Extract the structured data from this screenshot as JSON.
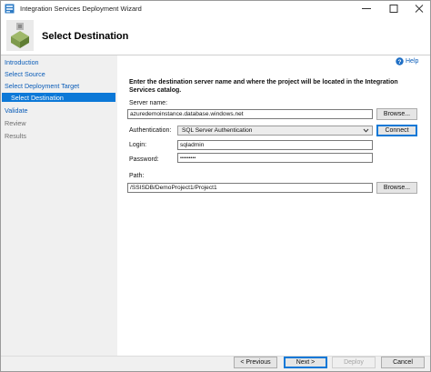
{
  "window": {
    "title": "Integration Services Deployment Wizard"
  },
  "header": {
    "title": "Select Destination"
  },
  "nav": {
    "items": [
      {
        "label": "Introduction"
      },
      {
        "label": "Select Source"
      },
      {
        "label": "Select Deployment Target"
      },
      {
        "label": "Select Destination"
      },
      {
        "label": "Validate"
      },
      {
        "label": "Review"
      },
      {
        "label": "Results"
      }
    ]
  },
  "main": {
    "help_label": "Help",
    "instruction": "Enter the destination server name and where the project will be located in the Integration Services catalog.",
    "server_name_label": "Server name:",
    "server_name_value": "azuredemoinstance.database.windows.net",
    "browse_label": "Browse...",
    "authentication_label": "Authentication:",
    "authentication_value": "SQL Server Authentication",
    "connect_label": "Connect",
    "login_label": "Login:",
    "login_value": "sqladmin",
    "password_label": "Password:",
    "password_value": "•••••••••",
    "path_label": "Path:",
    "path_value": "/SSISDB/DemoProject1/Project1",
    "path_browse_label": "Browse..."
  },
  "footer": {
    "previous_label": "< Previous",
    "next_label": "Next >",
    "deploy_label": "Deploy",
    "cancel_label": "Cancel"
  },
  "colors": {
    "accent": "#0c78d7",
    "link": "#0a5cb8",
    "nav_background": "#f0f0f0"
  },
  "icons": {
    "app": "ssis-wizard-icon",
    "header": "deployment-package-icon",
    "help": "help-icon",
    "dropdown": "chevron-down-icon"
  }
}
